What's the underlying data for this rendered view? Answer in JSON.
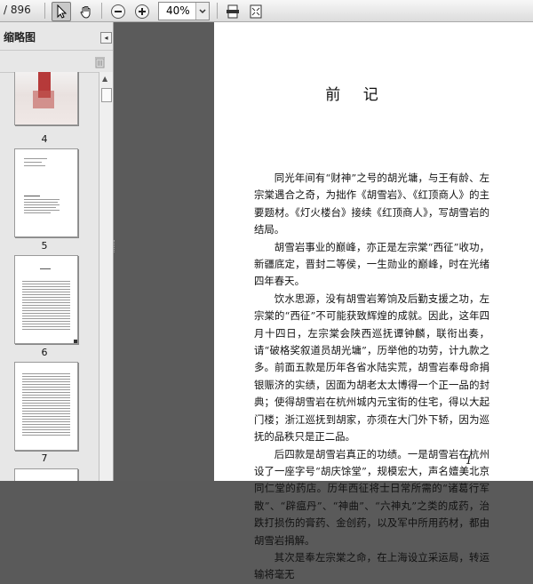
{
  "toolbar": {
    "page_total": "/ 896",
    "zoom_value": "40%"
  },
  "sidebar": {
    "title": "缩略图",
    "thumbnails": [
      {
        "label": "4"
      },
      {
        "label": "5"
      },
      {
        "label": "6"
      },
      {
        "label": "7"
      }
    ]
  },
  "document": {
    "title": "前  记",
    "paragraphs": [
      "同光年间有“财神”之号的胡光墉，与王有龄、左宗棠遇合之奇，为拙作《胡雪岩》、《红顶商人》的主要题材。《灯火楼台》接续《红顶商人》，写胡雪岩的结局。",
      "胡雪岩事业的巅峰，亦正是左宗棠“西征”收功，新疆底定，晋封二等侯，一生勋业的巅峰，时在光绪四年春天。",
      "饮水思源，没有胡雪岩筹饷及后勤支援之功，左宗棠的“西征”不可能获致辉煌的成就。因此，这年四月十四日，左宗棠会陕西巡抚谭钟麟，联衔出奏，请“破格奖叙道员胡光墉”，历举他的功劳，计九款之多。前面五款是历年各省水陆实荒，胡雪岩奉母命捐银赈济的实绩，因面为胡老太太博得一个正一品的封典；使得胡雪岩在杭州城内元宝街的住宅，得以大起门楼；浙江巡抚到胡家，亦须在大门外下轿，因为巡抚的品秩只是正二品。",
      "后四款是胡雪岩真正的功绩。一是胡雪岩在杭州设了一座字号“胡庆馀堂”，规模宏大，声名嬗美北京同仁堂的药店。历年西征将士日常所需的“诸葛行军散”、“辟瘟丹”、“神曲”、“六神丸”之类的成药，治跌打损伤的膏药、金创药，以及军中所用药材，都由胡雪岩捐解。",
      "其次是奉左宗棠之命，在上海设立采运局，转运输将毫无"
    ],
    "page_number": "1"
  }
}
